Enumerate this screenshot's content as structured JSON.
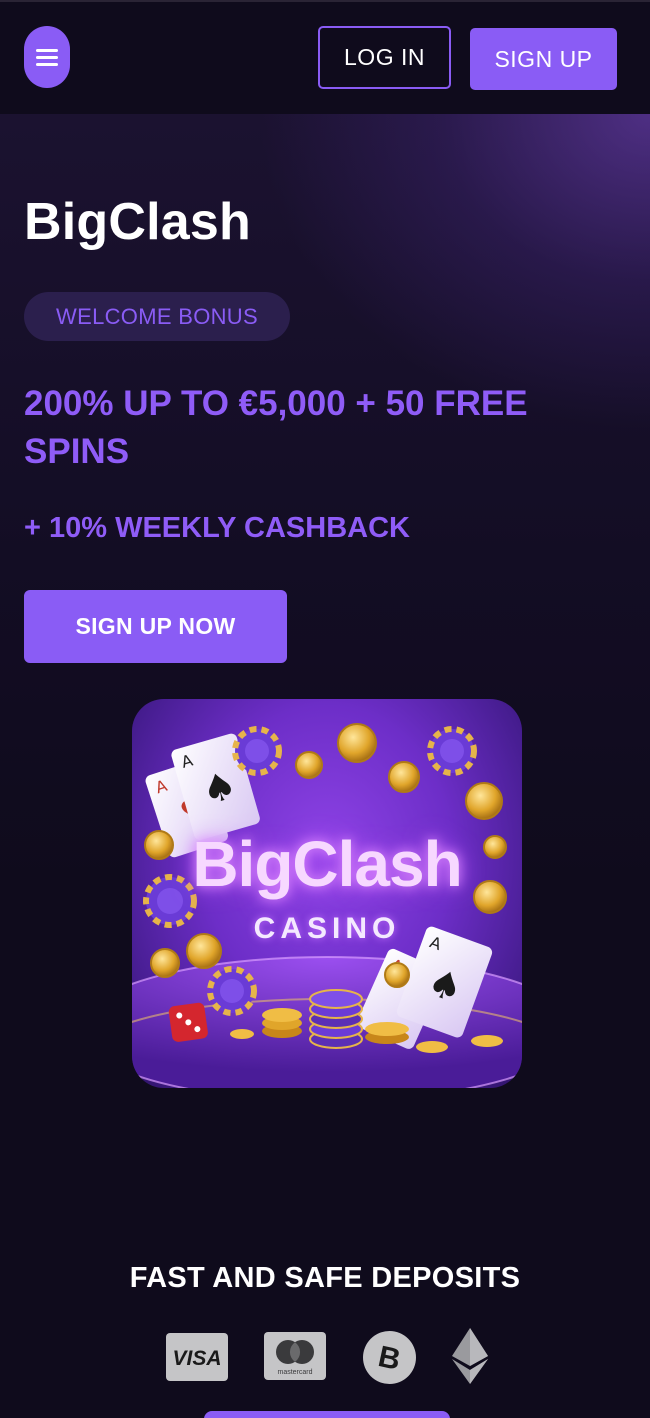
{
  "header": {
    "login_label": "LOG IN",
    "signup_label": "SIGN UP"
  },
  "hero": {
    "brand": "BigClash",
    "badge": "WELCOME BONUS",
    "offer": "200% UP TO €5,000 + 50 FREE SPINS",
    "cashback": "+ 10% WEEKLY CASHBACK",
    "cta_label": "SIGN UP NOW"
  },
  "promo_image": {
    "title": "BigClash",
    "subtitle": "CASINO"
  },
  "deposits": {
    "title": "FAST AND SAFE DEPOSITS",
    "methods": [
      {
        "icon": "visa-icon",
        "label": "VISA"
      },
      {
        "icon": "mastercard-icon",
        "label": "mastercard"
      },
      {
        "icon": "bitcoin-icon",
        "label": "B"
      },
      {
        "icon": "ethereum-icon",
        "label": ""
      }
    ]
  },
  "colors": {
    "accent": "#8a5cf5",
    "offer_text": "#8f5cf7",
    "background": "#0f0b1c",
    "badge_bg": "#2b1f4d"
  }
}
